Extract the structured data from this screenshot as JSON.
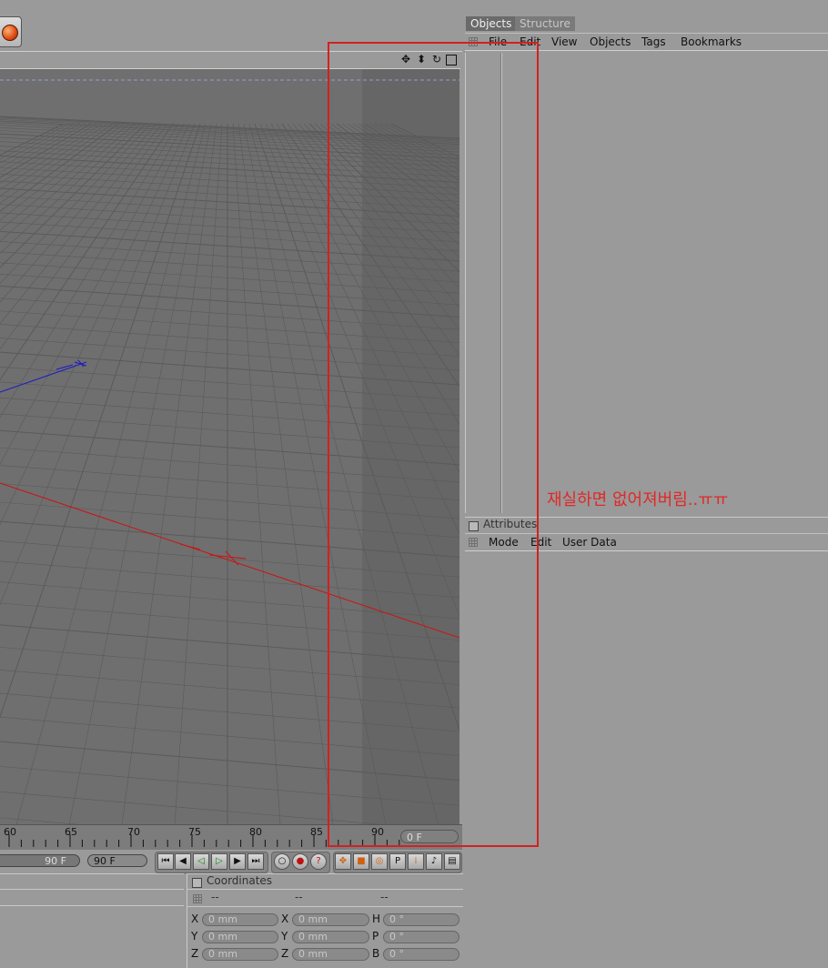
{
  "toolbar": {
    "render_button_icon": "globe-icon"
  },
  "viewport": {
    "header_icons": [
      "move-icon",
      "zoom-icon",
      "rotate-icon",
      "maximize-icon"
    ],
    "grid_color": "#5a5a5a",
    "axis_x_color": "#d01010",
    "axis_z_color": "#1010c0"
  },
  "timeline": {
    "ticks": [
      "60",
      "65",
      "70",
      "75",
      "80",
      "85",
      "90"
    ],
    "current_frame": "0 F"
  },
  "transport": {
    "end_frame_a": "90 F",
    "end_frame_b": "90 F",
    "playback_icons": [
      "go-to-start-icon",
      "step-back-icon",
      "play-backward-icon",
      "play-forward-icon",
      "step-forward-icon",
      "go-to-end-icon"
    ],
    "record_icons": [
      "record-auto-icon",
      "record-key-icon",
      "record-help-icon"
    ],
    "key_icons": [
      "move-key-icon",
      "scale-key-icon",
      "rotate-key-icon",
      "param-key-icon",
      "pla-key-icon",
      "sound-icon",
      "point-level-icon"
    ]
  },
  "coordinates": {
    "title": "Coordinates",
    "headers": [
      "--",
      "--",
      "--"
    ],
    "rows": [
      {
        "pos_label": "X",
        "pos_value": "0 mm",
        "size_label": "X",
        "size_value": "0 mm",
        "rot_label": "H",
        "rot_value": "0 °"
      },
      {
        "pos_label": "Y",
        "pos_value": "0 mm",
        "size_label": "Y",
        "size_value": "0 mm",
        "rot_label": "P",
        "rot_value": "0 °"
      },
      {
        "pos_label": "Z",
        "pos_value": "0 mm",
        "size_label": "Z",
        "size_value": "0 mm",
        "rot_label": "B",
        "rot_value": "0 °"
      }
    ]
  },
  "object_manager": {
    "tabs": [
      "Objects",
      "Structure"
    ],
    "menu": [
      "File",
      "Edit",
      "View",
      "Objects",
      "Tags",
      "Bookmarks"
    ]
  },
  "attributes": {
    "title": "Attributes",
    "menu": [
      "Mode",
      "Edit",
      "User Data"
    ]
  },
  "annotation": {
    "text": "재실하면 없어져버림..ㅠㅠ",
    "color": "#d42020"
  }
}
